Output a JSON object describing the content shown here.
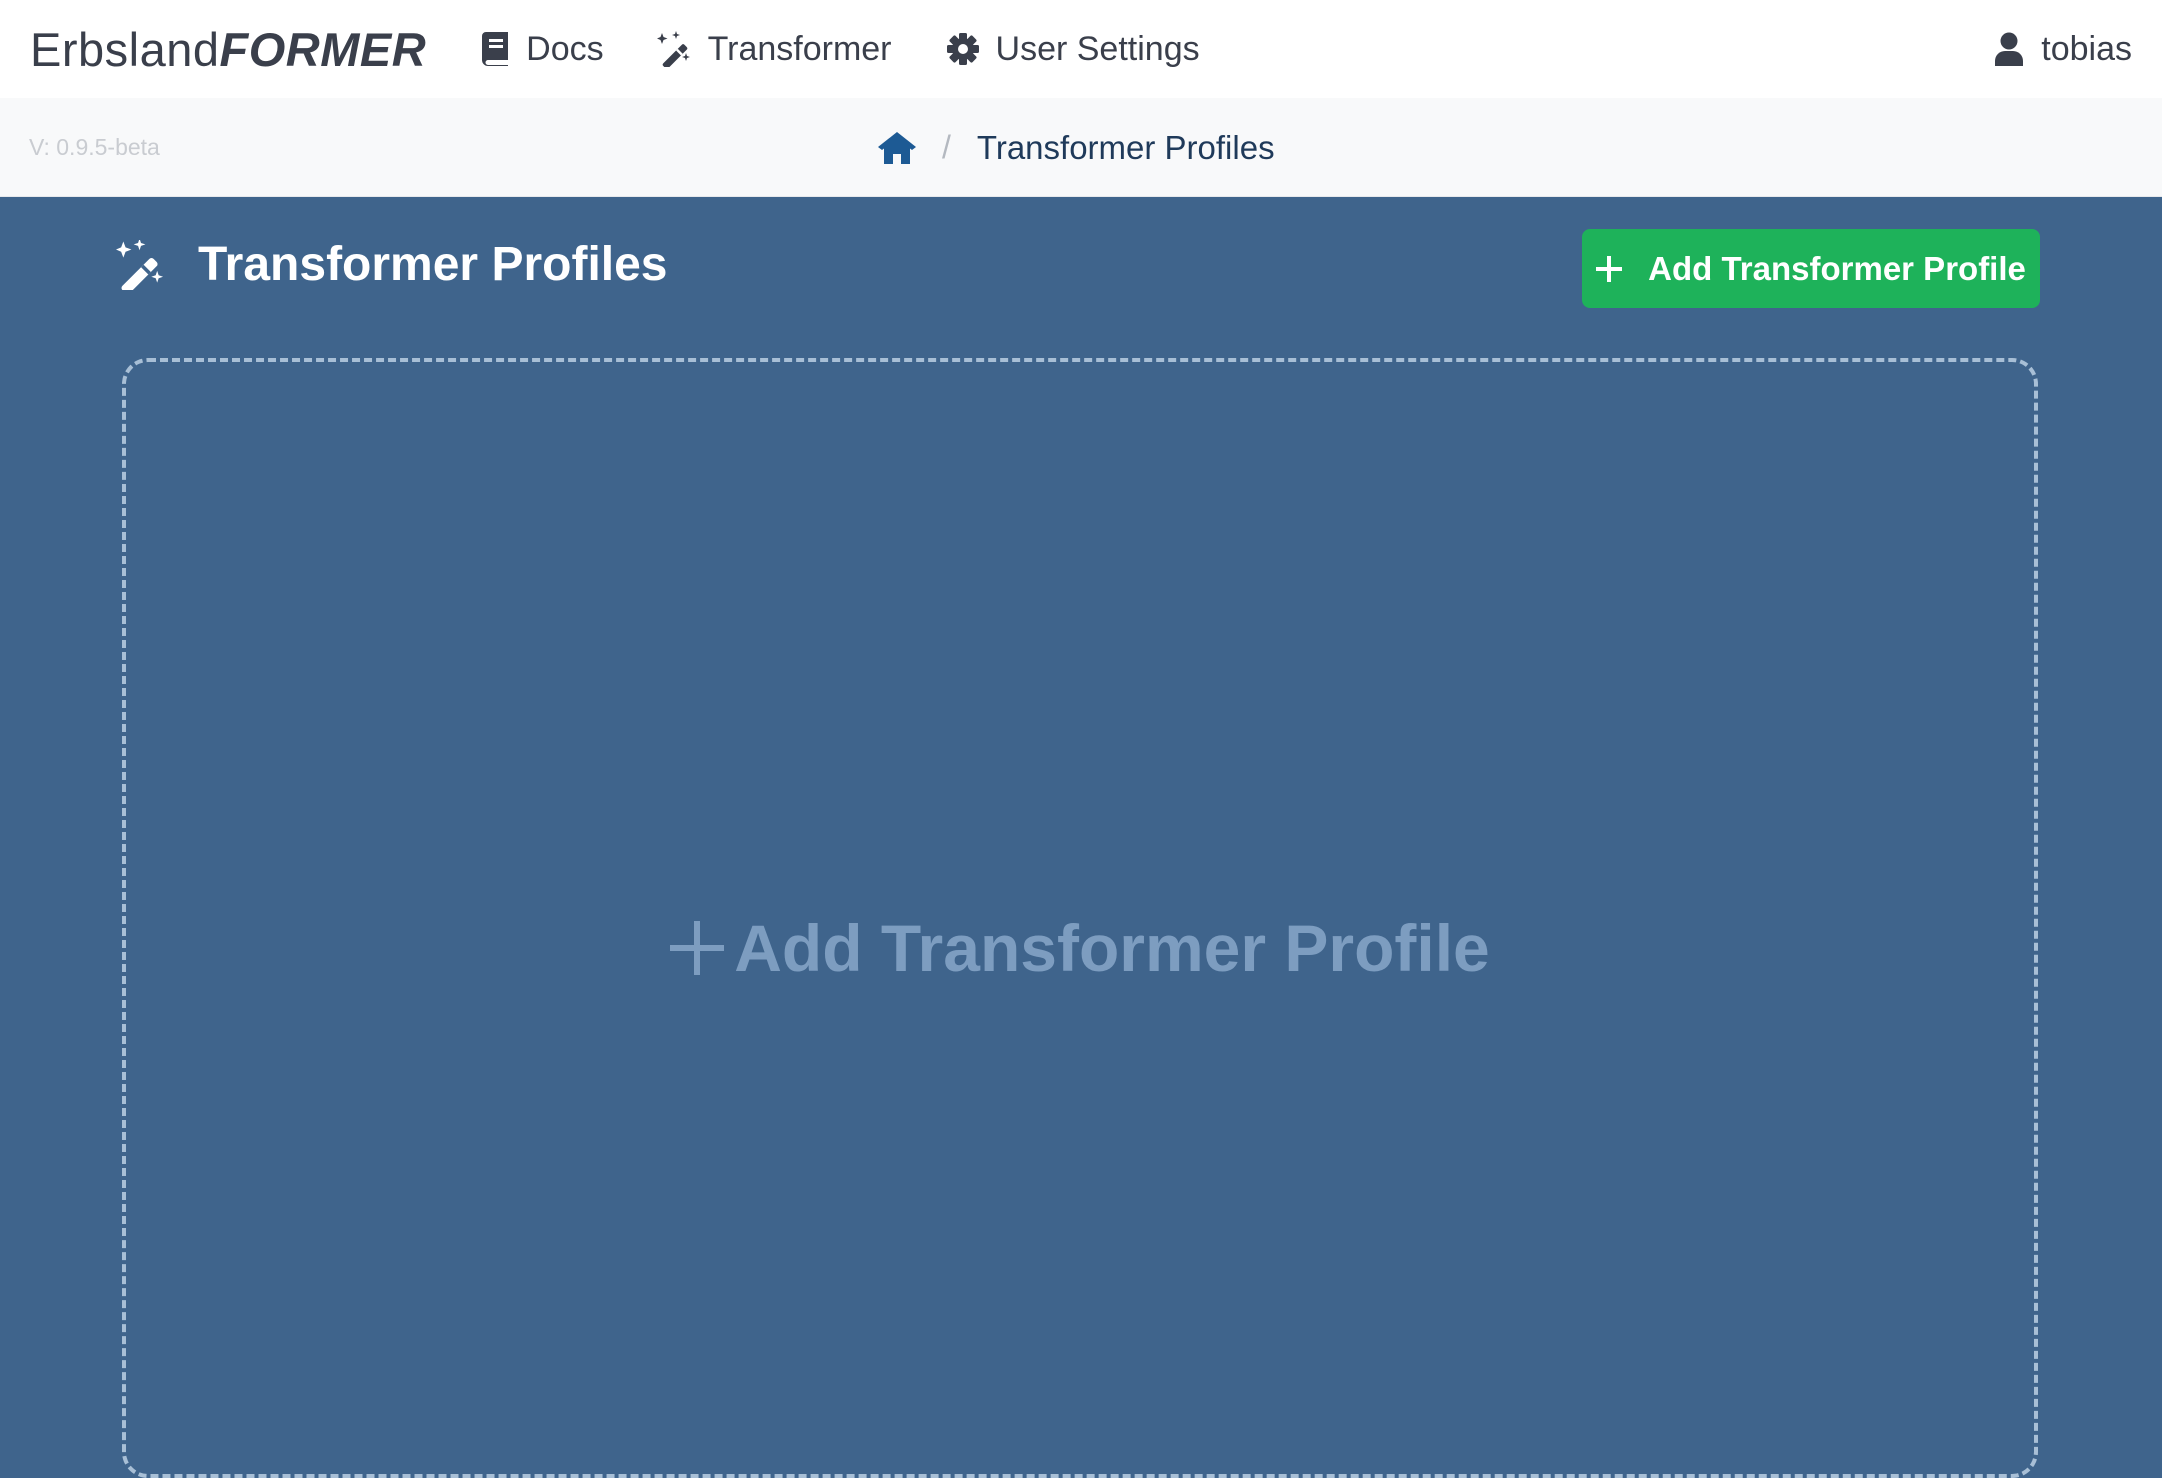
{
  "brand": {
    "name_regular": "Erbsland",
    "name_bold": "FORMER"
  },
  "nav": {
    "docs": {
      "label": "Docs",
      "icon": "book-icon"
    },
    "transformer": {
      "label": "Transformer",
      "icon": "magic-wand-icon"
    },
    "settings": {
      "label": "User Settings",
      "icon": "gear-icon"
    },
    "user": {
      "label": "tobias",
      "icon": "user-icon"
    }
  },
  "version": "V: 0.9.5-beta",
  "breadcrumb": {
    "home_icon": "home-icon",
    "separator": "/",
    "current": "Transformer Profiles"
  },
  "page": {
    "title": "Transformer Profiles",
    "title_icon": "magic-wand-icon",
    "add_button_label": "Add Transformer Profile",
    "empty_add_label": "Add Transformer Profile"
  },
  "colors": {
    "nav_bg": "#ffffff",
    "crumb_bg": "#f8f9fa",
    "main_bg": "#3f648c",
    "accent_green": "#1eb25a",
    "dashed_border": "#a8bfd6",
    "home_icon": "#1d5a94"
  }
}
